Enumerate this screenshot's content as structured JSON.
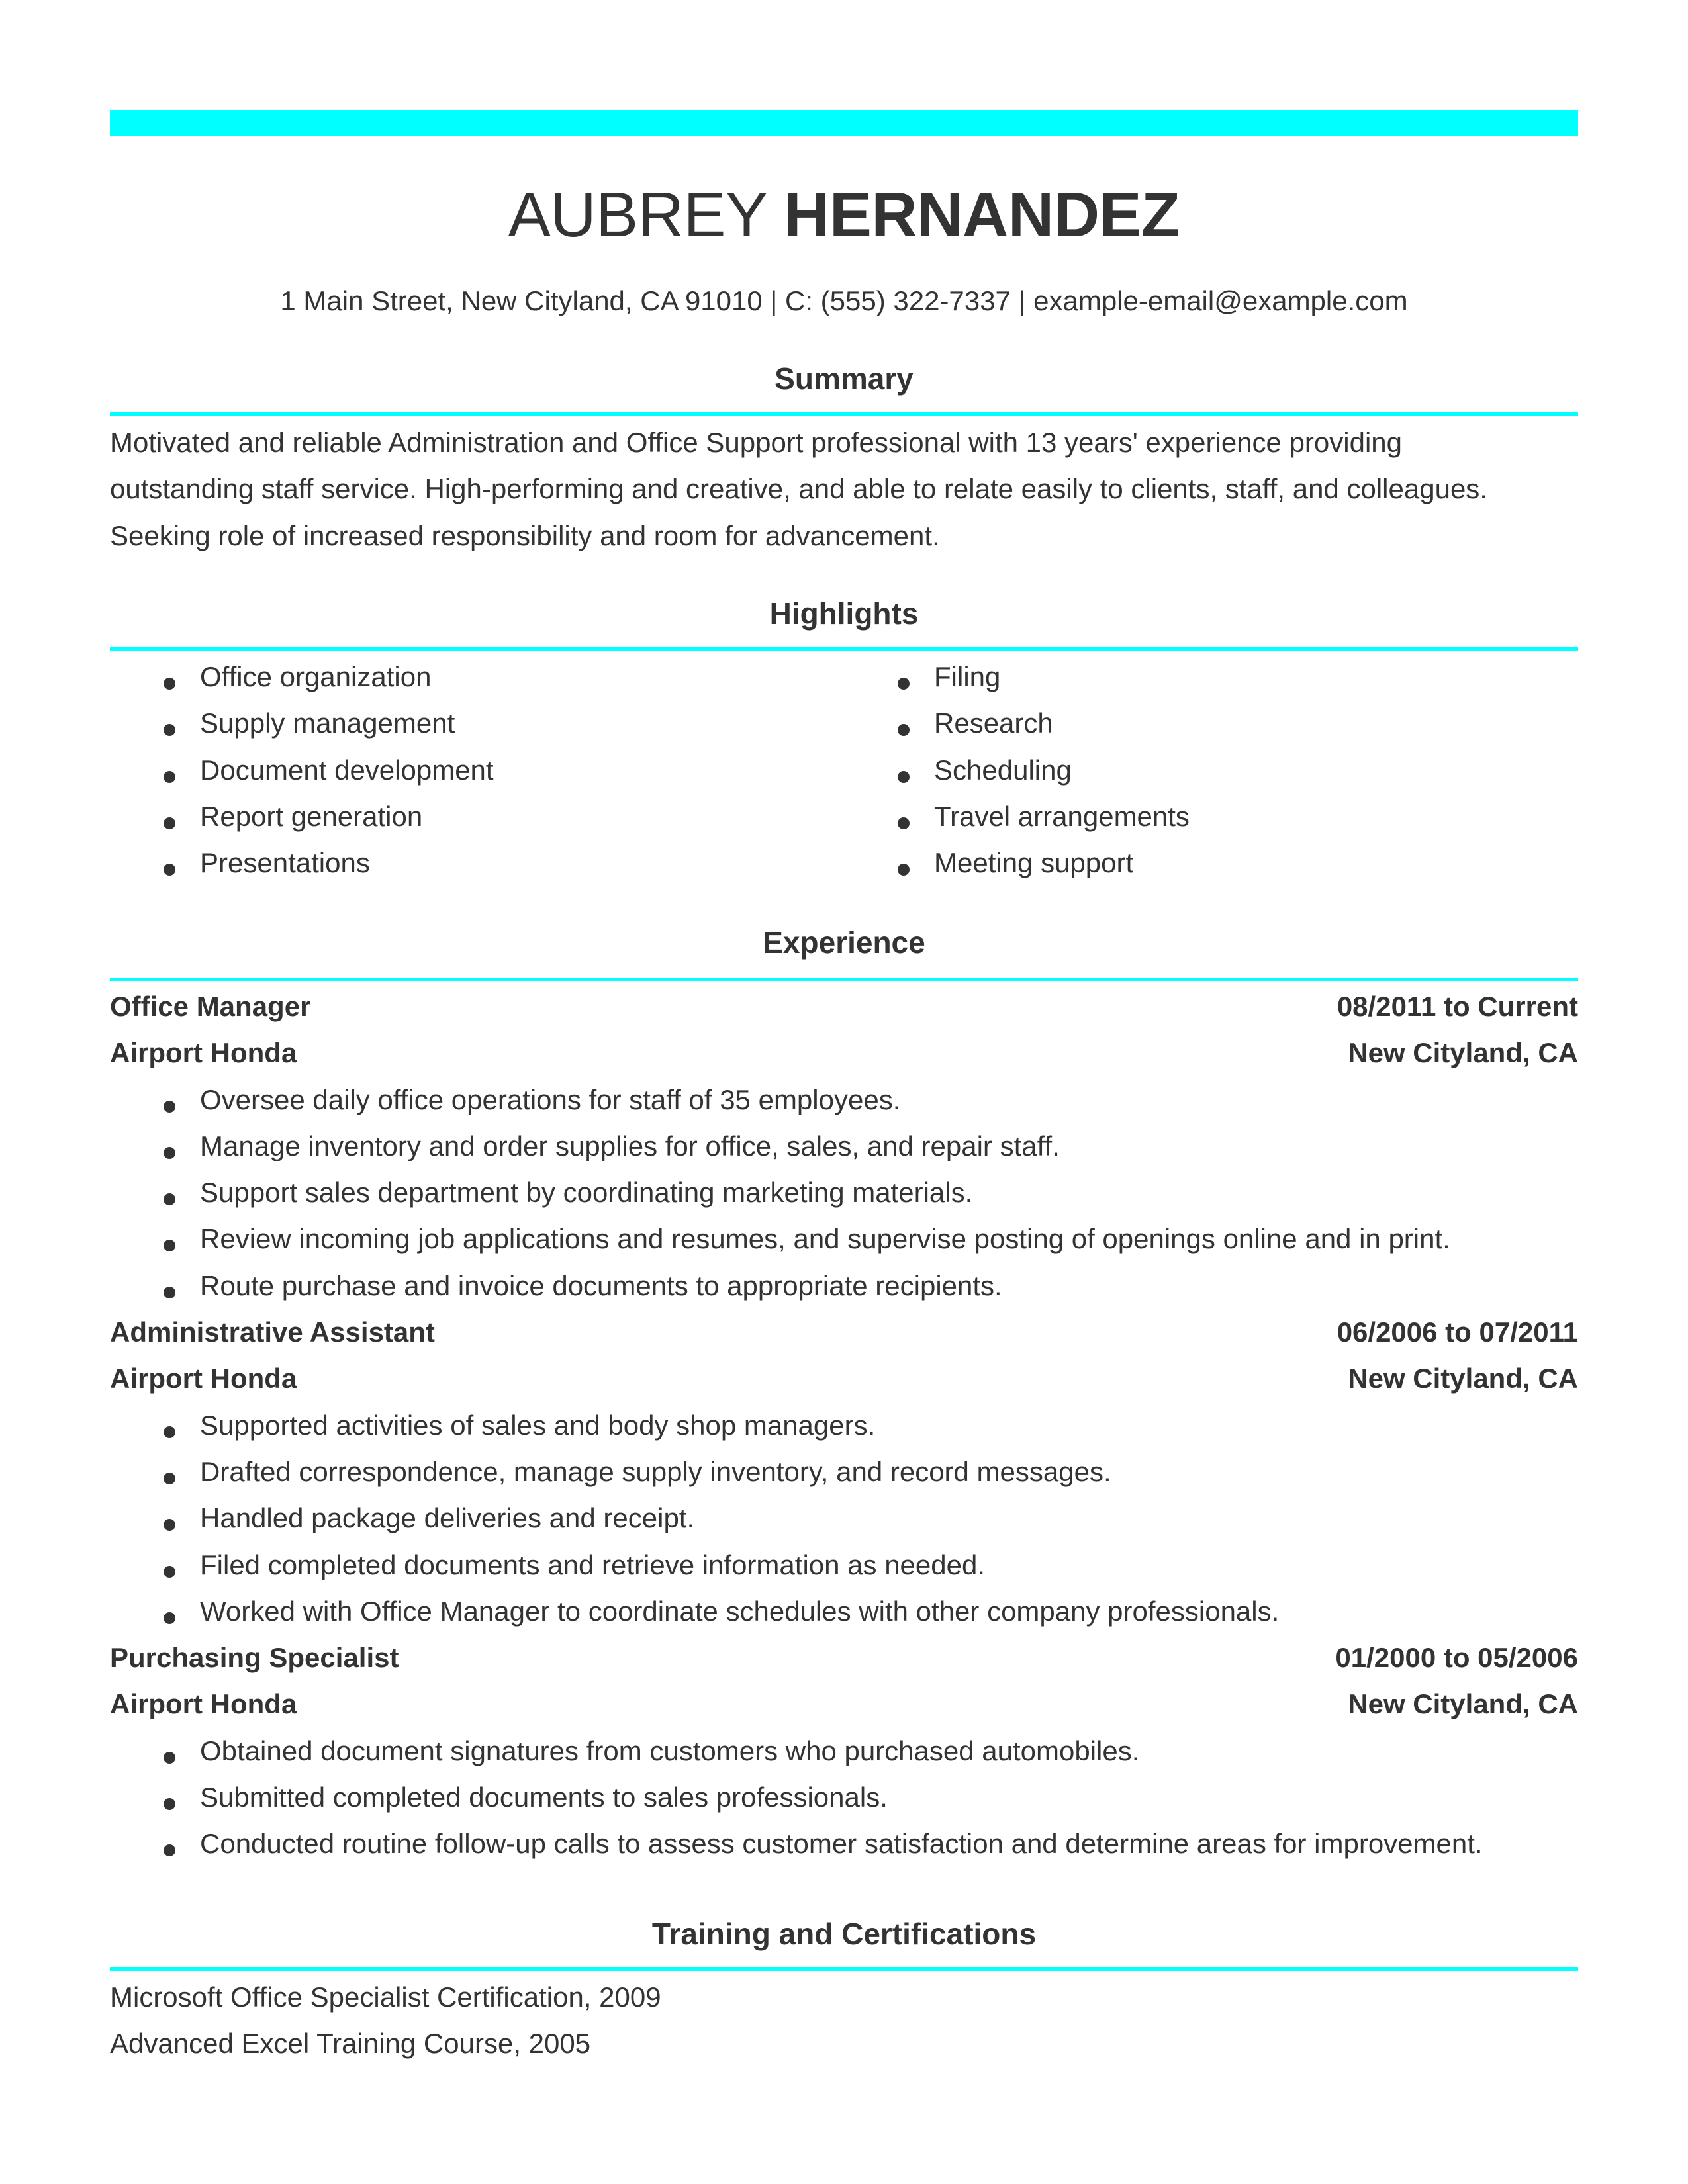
{
  "accent_color": "#00ffff",
  "text_color": "#333333",
  "header": {
    "first_name": "AUBREY",
    "last_name": "HERNANDEZ",
    "contact": "1 Main Street, New Cityland, CA 91010 | C: (555) 322-7337 | example-email@example.com"
  },
  "summary": {
    "heading": "Summary",
    "lines": [
      "Motivated and reliable Administration and Office Support professional with 13 years' experience providing",
      "outstanding staff service. High-performing and creative, and able to relate easily to clients, staff, and colleagues.",
      "Seeking role of increased responsibility and room for advancement."
    ]
  },
  "highlights": {
    "heading": "Highlights",
    "left": [
      "Office organization",
      "Supply management",
      "Document development",
      "Report generation",
      "Presentations"
    ],
    "right": [
      "Filing",
      "Research",
      "Scheduling",
      "Travel arrangements",
      "Meeting support"
    ]
  },
  "experience": {
    "heading": "Experience",
    "jobs": [
      {
        "title": "Office Manager",
        "dates": "08/2011 to Current",
        "company": "Airport Honda",
        "location": "New Cityland, CA",
        "bullets": [
          "Oversee daily office operations for staff of 35 employees.",
          "Manage inventory and order supplies for office, sales, and repair staff.",
          "Support sales department by coordinating marketing materials.",
          "Review incoming job applications and resumes, and supervise posting of openings online and in print.",
          "Route purchase and invoice documents to appropriate recipients."
        ]
      },
      {
        "title": "Administrative Assistant",
        "dates": "06/2006 to 07/2011",
        "company": "Airport Honda",
        "location": "New Cityland, CA",
        "bullets": [
          "Supported activities of sales and body shop managers.",
          "Drafted correspondence, manage supply inventory, and record messages.",
          "Handled package deliveries and receipt.",
          "Filed completed documents and retrieve information as needed.",
          "Worked with Office Manager to coordinate schedules with other company professionals."
        ]
      },
      {
        "title": "Purchasing Specialist",
        "dates": "01/2000 to 05/2006",
        "company": "Airport Honda",
        "location": "New Cityland, CA",
        "bullets": [
          "Obtained document signatures from customers who purchased automobiles.",
          "Submitted completed documents to sales professionals.",
          "Conducted routine follow-up calls to assess customer satisfaction and determine areas for improvement."
        ]
      }
    ]
  },
  "training": {
    "heading": "Training and Certifications",
    "items": [
      "Microsoft Office Specialist Certification, 2009",
      "Advanced Excel Training Course, 2005"
    ]
  }
}
